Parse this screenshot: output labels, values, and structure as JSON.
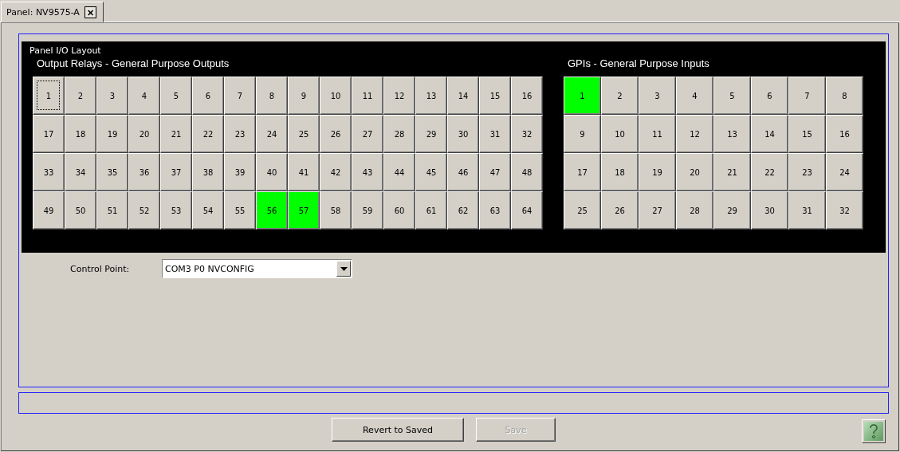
{
  "tab": {
    "label": "Panel: NV9575-A",
    "close": "✕",
    "selected": true
  },
  "panel": {
    "title": "Panel I/O Layout",
    "outputs": {
      "heading": "Output Relays - General Purpose Outputs",
      "buttons": [
        {
          "label": "1",
          "on": false,
          "focused": true
        },
        {
          "label": "2",
          "on": false,
          "focused": false
        },
        {
          "label": "3",
          "on": false,
          "focused": false
        },
        {
          "label": "4",
          "on": false,
          "focused": false
        },
        {
          "label": "5",
          "on": false,
          "focused": false
        },
        {
          "label": "6",
          "on": false,
          "focused": false
        },
        {
          "label": "7",
          "on": false,
          "focused": false
        },
        {
          "label": "8",
          "on": false,
          "focused": false
        },
        {
          "label": "9",
          "on": false,
          "focused": false
        },
        {
          "label": "10",
          "on": false,
          "focused": false
        },
        {
          "label": "11",
          "on": false,
          "focused": false
        },
        {
          "label": "12",
          "on": false,
          "focused": false
        },
        {
          "label": "13",
          "on": false,
          "focused": false
        },
        {
          "label": "14",
          "on": false,
          "focused": false
        },
        {
          "label": "15",
          "on": false,
          "focused": false
        },
        {
          "label": "16",
          "on": false,
          "focused": false
        },
        {
          "label": "17",
          "on": false,
          "focused": false
        },
        {
          "label": "18",
          "on": false,
          "focused": false
        },
        {
          "label": "19",
          "on": false,
          "focused": false
        },
        {
          "label": "20",
          "on": false,
          "focused": false
        },
        {
          "label": "21",
          "on": false,
          "focused": false
        },
        {
          "label": "22",
          "on": false,
          "focused": false
        },
        {
          "label": "23",
          "on": false,
          "focused": false
        },
        {
          "label": "24",
          "on": false,
          "focused": false
        },
        {
          "label": "25",
          "on": false,
          "focused": false
        },
        {
          "label": "26",
          "on": false,
          "focused": false
        },
        {
          "label": "27",
          "on": false,
          "focused": false
        },
        {
          "label": "28",
          "on": false,
          "focused": false
        },
        {
          "label": "29",
          "on": false,
          "focused": false
        },
        {
          "label": "30",
          "on": false,
          "focused": false
        },
        {
          "label": "31",
          "on": false,
          "focused": false
        },
        {
          "label": "32",
          "on": false,
          "focused": false
        },
        {
          "label": "33",
          "on": false,
          "focused": false
        },
        {
          "label": "34",
          "on": false,
          "focused": false
        },
        {
          "label": "35",
          "on": false,
          "focused": false
        },
        {
          "label": "36",
          "on": false,
          "focused": false
        },
        {
          "label": "37",
          "on": false,
          "focused": false
        },
        {
          "label": "38",
          "on": false,
          "focused": false
        },
        {
          "label": "39",
          "on": false,
          "focused": false
        },
        {
          "label": "40",
          "on": false,
          "focused": false
        },
        {
          "label": "41",
          "on": false,
          "focused": false
        },
        {
          "label": "42",
          "on": false,
          "focused": false
        },
        {
          "label": "43",
          "on": false,
          "focused": false
        },
        {
          "label": "44",
          "on": false,
          "focused": false
        },
        {
          "label": "45",
          "on": false,
          "focused": false
        },
        {
          "label": "46",
          "on": false,
          "focused": false
        },
        {
          "label": "47",
          "on": false,
          "focused": false
        },
        {
          "label": "48",
          "on": false,
          "focused": false
        },
        {
          "label": "49",
          "on": false,
          "focused": false
        },
        {
          "label": "50",
          "on": false,
          "focused": false
        },
        {
          "label": "51",
          "on": false,
          "focused": false
        },
        {
          "label": "52",
          "on": false,
          "focused": false
        },
        {
          "label": "53",
          "on": false,
          "focused": false
        },
        {
          "label": "54",
          "on": false,
          "focused": false
        },
        {
          "label": "55",
          "on": false,
          "focused": false
        },
        {
          "label": "56",
          "on": true,
          "focused": false
        },
        {
          "label": "57",
          "on": true,
          "focused": false
        },
        {
          "label": "58",
          "on": false,
          "focused": false
        },
        {
          "label": "59",
          "on": false,
          "focused": false
        },
        {
          "label": "60",
          "on": false,
          "focused": false
        },
        {
          "label": "61",
          "on": false,
          "focused": false
        },
        {
          "label": "62",
          "on": false,
          "focused": false
        },
        {
          "label": "63",
          "on": false,
          "focused": false
        },
        {
          "label": "64",
          "on": false,
          "focused": false
        }
      ]
    },
    "inputs": {
      "heading": "GPIs - General Purpose Inputs",
      "buttons": [
        {
          "label": "1",
          "on": true
        },
        {
          "label": "2",
          "on": false
        },
        {
          "label": "3",
          "on": false
        },
        {
          "label": "4",
          "on": false
        },
        {
          "label": "5",
          "on": false
        },
        {
          "label": "6",
          "on": false
        },
        {
          "label": "7",
          "on": false
        },
        {
          "label": "8",
          "on": false
        },
        {
          "label": "9",
          "on": false
        },
        {
          "label": "10",
          "on": false
        },
        {
          "label": "11",
          "on": false
        },
        {
          "label": "12",
          "on": false
        },
        {
          "label": "13",
          "on": false
        },
        {
          "label": "14",
          "on": false
        },
        {
          "label": "15",
          "on": false
        },
        {
          "label": "16",
          "on": false
        },
        {
          "label": "17",
          "on": false
        },
        {
          "label": "18",
          "on": false
        },
        {
          "label": "19",
          "on": false
        },
        {
          "label": "20",
          "on": false
        },
        {
          "label": "21",
          "on": false
        },
        {
          "label": "22",
          "on": false
        },
        {
          "label": "23",
          "on": false
        },
        {
          "label": "24",
          "on": false
        },
        {
          "label": "25",
          "on": false
        },
        {
          "label": "26",
          "on": false
        },
        {
          "label": "27",
          "on": false
        },
        {
          "label": "28",
          "on": false
        },
        {
          "label": "29",
          "on": false
        },
        {
          "label": "30",
          "on": false
        },
        {
          "label": "31",
          "on": false
        },
        {
          "label": "32",
          "on": false
        }
      ]
    }
  },
  "control_point": {
    "label": "Control Point:",
    "value": "COM3 P0 NVCONFIG"
  },
  "buttons": [
    {
      "label": "Revert to Saved",
      "disabled": false
    },
    {
      "label": "Save",
      "disabled": true
    }
  ]
}
